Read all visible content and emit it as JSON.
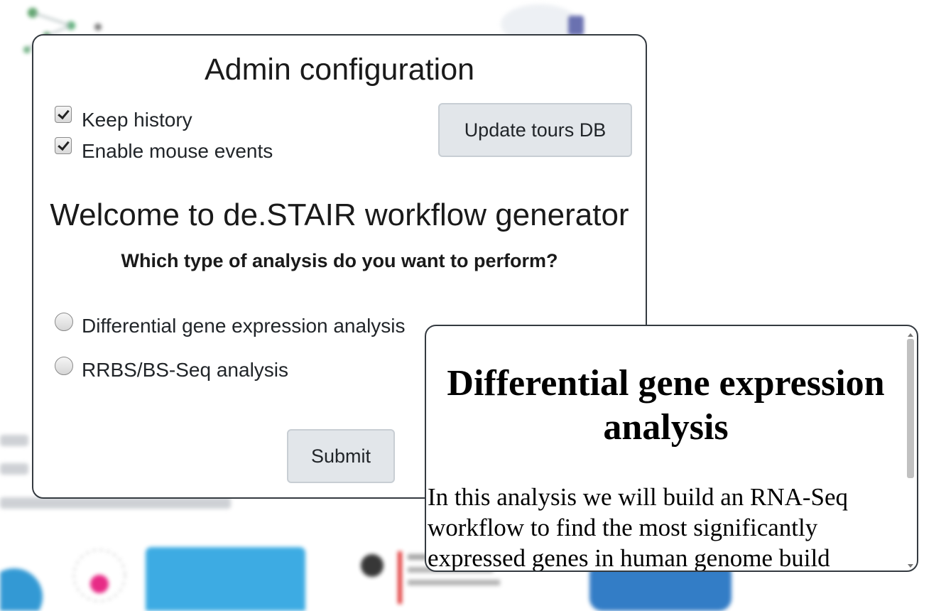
{
  "admin": {
    "title": "Admin configuration",
    "keep_history_label": "Keep history",
    "mouse_events_label": "Enable mouse events",
    "update_button": "Update tours DB"
  },
  "welcome": {
    "title": "Welcome to de.STAIR workflow generator",
    "question": "Which type of analysis do you want to perform?",
    "options": [
      {
        "label": "Differential gene expression analysis",
        "checked": false
      },
      {
        "label": "RRBS/BS-Seq analysis",
        "checked": false
      }
    ],
    "submit_button": "Submit"
  },
  "description": {
    "title": "Differential gene expression analysis",
    "body": "In this analysis we will build an RNA-Seq workflow to find the most significantly expressed genes in human genome build"
  },
  "colors": {
    "panel_border": "#343a40",
    "button_bg": "#e2e6ea",
    "button_border": "#c8ced4",
    "logo_blue": "#29a3e0",
    "logo_pink": "#e5157a"
  }
}
